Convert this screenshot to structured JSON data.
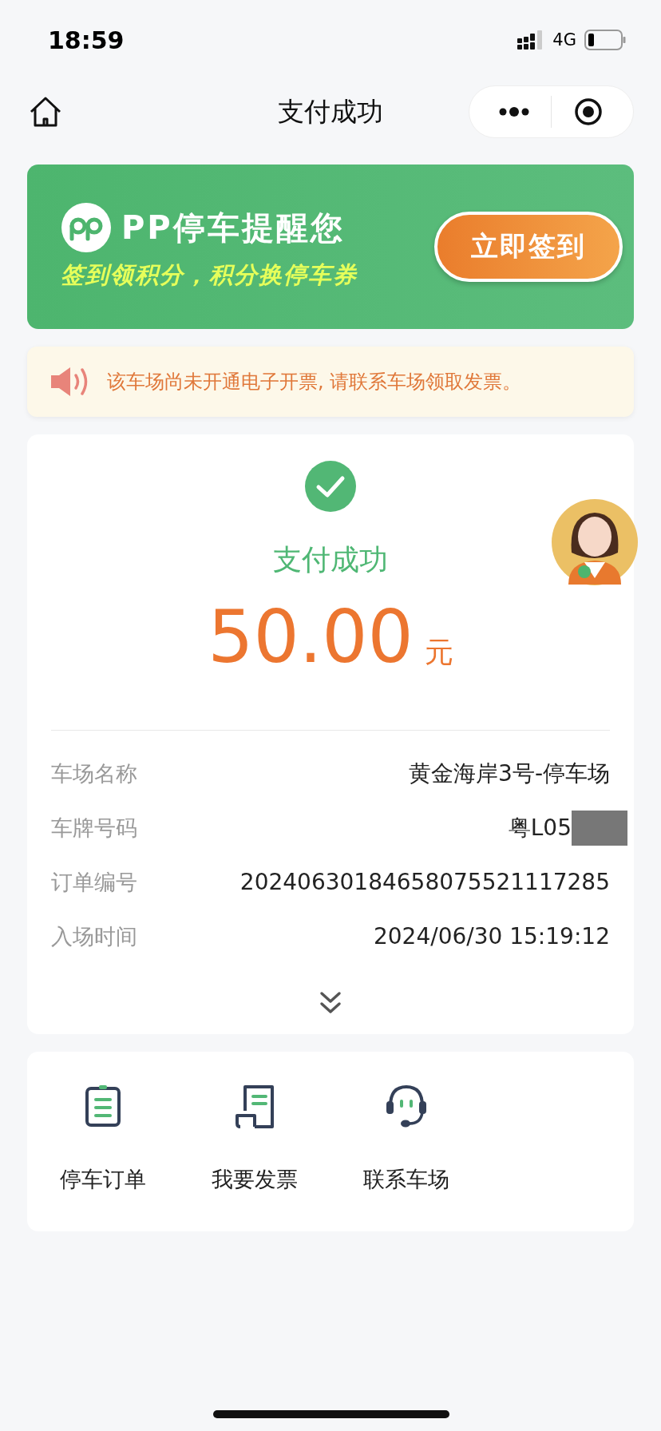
{
  "status_bar": {
    "time": "18:59",
    "network": "4G"
  },
  "nav": {
    "title": "支付成功"
  },
  "banner": {
    "title": "PP停车提醒您",
    "subtitle": "签到领积分，积分换停车券",
    "button": "立即签到"
  },
  "notice": {
    "text": "该车场尚未开通电子开票, 请联系车场领取发票。"
  },
  "result": {
    "status": "支付成功",
    "amount": "50.00",
    "currency": "元"
  },
  "details": [
    {
      "label": "车场名称",
      "value": "黄金海岸3号-停车场",
      "redacted": false
    },
    {
      "label": "车牌号码",
      "value": "粤L05",
      "redacted": true
    },
    {
      "label": "订单编号",
      "value": "20240630184658075521117285",
      "redacted": false
    },
    {
      "label": "入场时间",
      "value": "2024/06/30 15:19:12",
      "redacted": false
    }
  ],
  "actions": [
    {
      "label": "停车订单",
      "kind": "orders"
    },
    {
      "label": "我要发票",
      "kind": "invoice"
    },
    {
      "label": "联系车场",
      "kind": "support"
    }
  ]
}
